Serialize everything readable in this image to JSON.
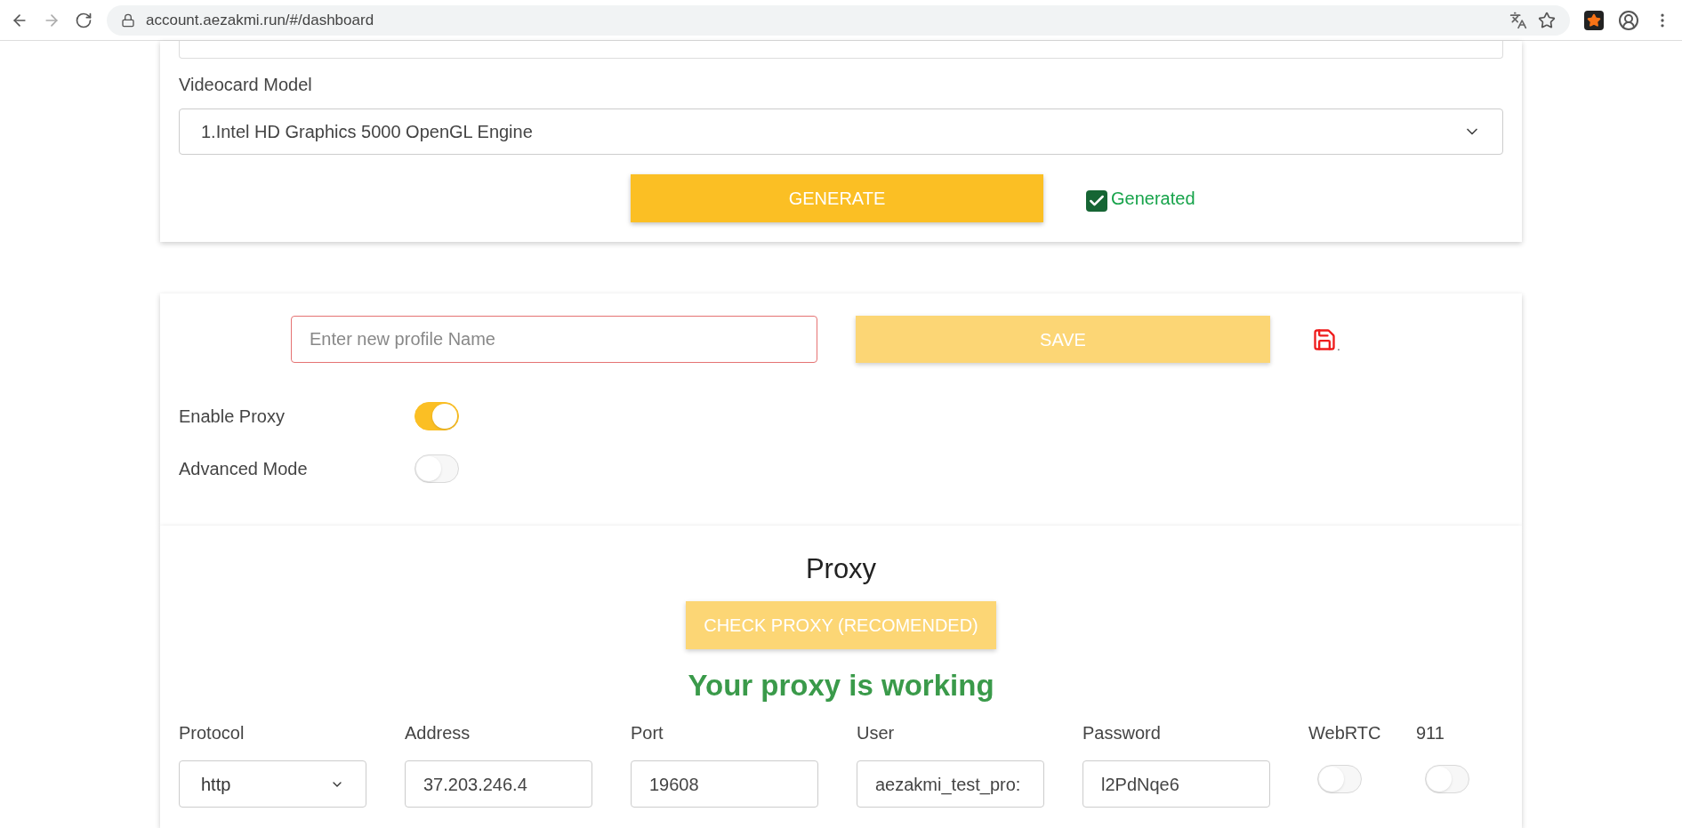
{
  "browser": {
    "url": "account.aezakmi.run/#/dashboard"
  },
  "hardware_card": {
    "videocard": {
      "label": "Videocard Model",
      "value": "1.Intel HD Graphics 5000 OpenGL Engine"
    },
    "generate_button": "GENERATE",
    "generated": {
      "checked": true,
      "label": "Generated"
    }
  },
  "profile_card": {
    "name_field": {
      "placeholder": "Enter new profile Name"
    },
    "save_button": "SAVE",
    "save_note": ".",
    "toggles": [
      {
        "label": "Enable Proxy",
        "on": true
      },
      {
        "label": "Advanced Mode",
        "on": false
      }
    ]
  },
  "proxy_card": {
    "title": "Proxy",
    "check_button": "CHECK PROXY (RECOMENDED)",
    "status": "Your proxy is working",
    "fields": [
      {
        "kind": "select",
        "label": "Protocol",
        "value": "http"
      },
      {
        "kind": "input",
        "label": "Address",
        "value": "37.203.246.4"
      },
      {
        "kind": "input",
        "label": "Port",
        "value": "19608"
      },
      {
        "kind": "input",
        "label": "User",
        "value": "aezakmi_test_pro:"
      },
      {
        "kind": "input",
        "label": "Password",
        "value": "l2PdNqe6"
      },
      {
        "kind": "toggle",
        "label": "WebRTC",
        "on": false
      },
      {
        "kind": "toggle",
        "label": "911",
        "on": false
      }
    ]
  }
}
